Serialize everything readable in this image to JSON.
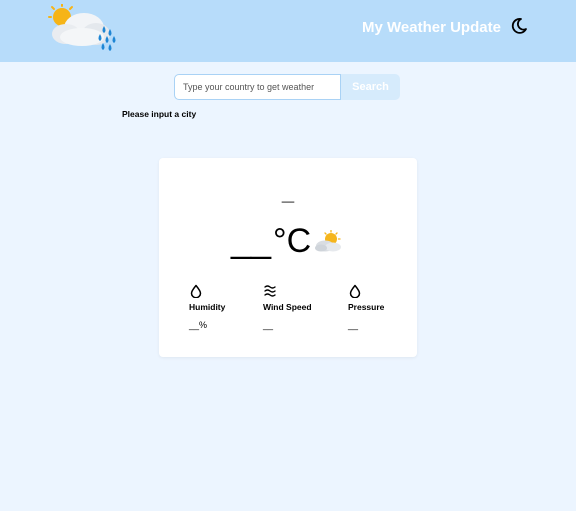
{
  "header": {
    "app_title": "My Weather Update",
    "logo_icon": "cloud-sun-rain-icon",
    "theme_toggle_icon": "moon-icon"
  },
  "search": {
    "placeholder": "Type your country to get weather",
    "value": "",
    "button_label": "Search"
  },
  "status_message": "Please input a city",
  "weather": {
    "city": "_",
    "temperature": "__",
    "unit": "°C",
    "condition_icon": "partly-cloudy-icon",
    "stats": [
      {
        "label": "Humidity",
        "value": "__%",
        "icon": "droplet-icon"
      },
      {
        "label": "Wind Speed",
        "value": "__",
        "icon": "wind-icon"
      },
      {
        "label": "Pressure",
        "value": "__",
        "icon": "droplet-icon"
      }
    ]
  },
  "colors": {
    "header_bg": "#b7dcfa",
    "page_bg": "#ecf5ff",
    "card_bg": "#ffffff",
    "search_button_bg": "#d6ebfc"
  }
}
